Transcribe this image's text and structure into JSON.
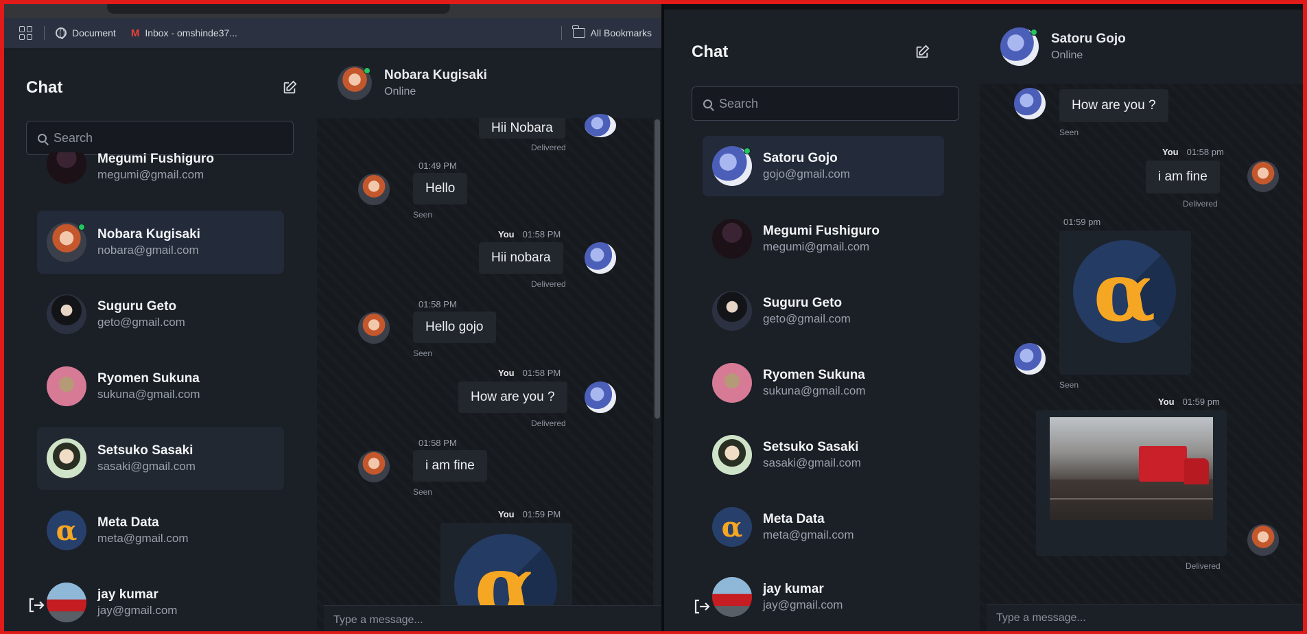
{
  "left": {
    "bookmarks": {
      "items": [
        {
          "label": "Document"
        },
        {
          "label": "Inbox - omshinde37..."
        }
      ],
      "all_bookmarks": "All Bookmarks"
    },
    "sidebar": {
      "title": "Chat",
      "search_placeholder": "Search",
      "contacts": [
        {
          "name": "Megumi Fushiguro",
          "email": "megumi@gmail.com"
        },
        {
          "name": "Nobara Kugisaki",
          "email": "nobara@gmail.com"
        },
        {
          "name": "Suguru Geto",
          "email": "geto@gmail.com"
        },
        {
          "name": "Ryomen Sukuna",
          "email": "sukuna@gmail.com"
        },
        {
          "name": "Setsuko Sasaki",
          "email": "sasaki@gmail.com"
        },
        {
          "name": "Meta Data",
          "email": "meta@gmail.com"
        },
        {
          "name": "jay kumar",
          "email": "jay@gmail.com"
        }
      ]
    },
    "chat": {
      "header_name": "Nobara Kugisaki",
      "header_status": "Online",
      "messages": [
        {
          "text": "Hii Nobara",
          "receipt": "Delivered"
        },
        {
          "time": "01:49 PM",
          "text": "Hello",
          "receipt": "Seen"
        },
        {
          "sender": "You",
          "time": "01:58 PM",
          "text": "Hii nobara",
          "receipt": "Delivered"
        },
        {
          "time": "01:58 PM",
          "text": "Hello gojo",
          "receipt": "Seen"
        },
        {
          "sender": "You",
          "time": "01:58 PM",
          "text": "How are you ?",
          "receipt": "Delivered"
        },
        {
          "time": "01:58 PM",
          "text": "i am fine",
          "receipt": "Seen"
        },
        {
          "sender": "You",
          "time": "01:59 PM",
          "image": "alpha"
        }
      ],
      "input_placeholder": "Type a message..."
    }
  },
  "right": {
    "sidebar": {
      "title": "Chat",
      "search_placeholder": "Search",
      "contacts": [
        {
          "name": "Satoru Gojo",
          "email": "gojo@gmail.com"
        },
        {
          "name": "Megumi Fushiguro",
          "email": "megumi@gmail.com"
        },
        {
          "name": "Suguru Geto",
          "email": "geto@gmail.com"
        },
        {
          "name": "Ryomen Sukuna",
          "email": "sukuna@gmail.com"
        },
        {
          "name": "Setsuko Sasaki",
          "email": "sasaki@gmail.com"
        },
        {
          "name": "Meta Data",
          "email": "meta@gmail.com"
        },
        {
          "name": "jay kumar",
          "email": "jay@gmail.com"
        }
      ]
    },
    "chat": {
      "header_name": "Satoru Gojo",
      "header_status": "Online",
      "messages": [
        {
          "text": "How are you ?",
          "receipt": "Seen"
        },
        {
          "sender": "You",
          "time": "01:58 pm",
          "text": "i am fine",
          "receipt": "Delivered"
        },
        {
          "time": "01:59 pm",
          "image": "alpha",
          "receipt": "Seen"
        },
        {
          "sender": "You",
          "time": "01:59 pm",
          "image": "truck",
          "receipt": "Delivered"
        }
      ],
      "input_placeholder": "Type a message..."
    }
  },
  "glyphs": {
    "alpha": "α"
  },
  "colors": {
    "accent_online": "#22c55e",
    "frame": "#e11a1a",
    "panel": "#1b1f26",
    "bubble": "#22262d",
    "alpha_orange": "#f5a623"
  }
}
